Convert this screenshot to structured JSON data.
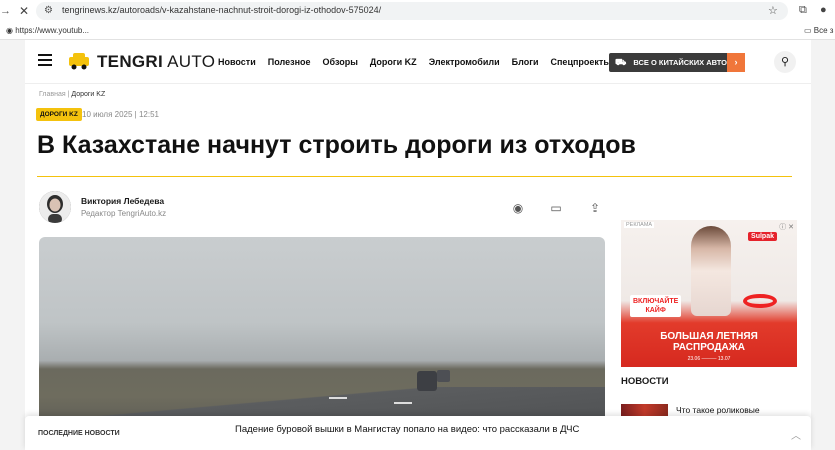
{
  "browser": {
    "url": "tengrinews.kz/autoroads/v-kazahstane-nachnut-stroit-dorogi-iz-othodov-575024/",
    "bookmark": "https://www.youtub...",
    "bookmark_right": "Все з"
  },
  "header": {
    "logo_bold": "TENGRI",
    "logo_thin": " AUTO",
    "nav": [
      "Новости",
      "Полезное",
      "Обзоры",
      "Дороги KZ",
      "Электромобили",
      "Блоги",
      "Спецпроекты"
    ],
    "promo": "ВСЕ О КИТАЙСКИХ АВТО"
  },
  "article": {
    "breadcrumb_home": "Главная",
    "breadcrumb_sep": " | ",
    "breadcrumb_current": "Дороги KZ",
    "tag": "ДОРОГИ KZ",
    "date": "10 июля 2025 | 12:51",
    "title": "В Казахстане начнут строить дороги из отходов",
    "author_name": "Виктория Лебедева",
    "author_role": "Редактор TengriAuto.kz"
  },
  "ad": {
    "label": "РЕКЛАМА",
    "brand": "Sulpak",
    "cta_line1": "ВКЛЮЧАЙТЕ",
    "cta_line2": "КАЙФ",
    "sale_line1": "БОЛЬШАЯ ЛЕТНЯЯ",
    "sale_line2": "РАСПРОДАЖА",
    "dates": "23.06 ——— 13.07"
  },
  "sidebar_news": {
    "heading": "НОВОСТИ",
    "first_title": "Что такое роликовые"
  },
  "latest_bar": {
    "label": "ПОСЛЕДНИЕ НОВОСТИ",
    "headline": "Падение буровой вышки в Мангистау попало на видео: что рассказали в ДЧС"
  },
  "colors": {
    "accent_yellow": "#f4c20d",
    "promo_orange": "#f0763a",
    "ad_red": "#e22"
  }
}
